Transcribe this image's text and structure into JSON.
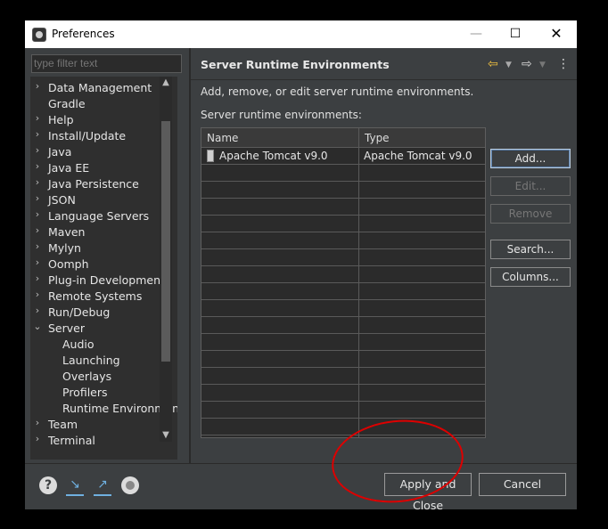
{
  "window": {
    "title": "Preferences",
    "minimize": "—",
    "maximize": "☐",
    "close": "✕"
  },
  "filter": {
    "placeholder": "type filter text"
  },
  "tree": [
    {
      "label": "Data Management",
      "expand": ">",
      "indent": 0
    },
    {
      "label": "Gradle",
      "expand": "",
      "indent": 0
    },
    {
      "label": "Help",
      "expand": ">",
      "indent": 0
    },
    {
      "label": "Install/Update",
      "expand": ">",
      "indent": 0
    },
    {
      "label": "Java",
      "expand": ">",
      "indent": 0
    },
    {
      "label": "Java EE",
      "expand": ">",
      "indent": 0
    },
    {
      "label": "Java Persistence",
      "expand": ">",
      "indent": 0
    },
    {
      "label": "JSON",
      "expand": ">",
      "indent": 0
    },
    {
      "label": "Language Servers",
      "expand": ">",
      "indent": 0
    },
    {
      "label": "Maven",
      "expand": ">",
      "indent": 0
    },
    {
      "label": "Mylyn",
      "expand": ">",
      "indent": 0
    },
    {
      "label": "Oomph",
      "expand": ">",
      "indent": 0
    },
    {
      "label": "Plug-in Development",
      "expand": ">",
      "indent": 0
    },
    {
      "label": "Remote Systems",
      "expand": ">",
      "indent": 0
    },
    {
      "label": "Run/Debug",
      "expand": ">",
      "indent": 0
    },
    {
      "label": "Server",
      "expand": "v",
      "indent": 0
    },
    {
      "label": "Audio",
      "expand": "",
      "indent": 1
    },
    {
      "label": "Launching",
      "expand": "",
      "indent": 1
    },
    {
      "label": "Overlays",
      "expand": "",
      "indent": 1
    },
    {
      "label": "Profilers",
      "expand": "",
      "indent": 1
    },
    {
      "label": "Runtime Environmen",
      "expand": "",
      "indent": 1
    },
    {
      "label": "Team",
      "expand": ">",
      "indent": 0
    },
    {
      "label": "Terminal",
      "expand": ">",
      "indent": 0
    }
  ],
  "page": {
    "title": "Server Runtime Environments",
    "description": "Add, remove, or edit server runtime environments.",
    "list_label": "Server runtime environments:"
  },
  "table": {
    "columns": [
      "Name",
      "Type"
    ],
    "rows": [
      {
        "name": "Apache Tomcat v9.0",
        "type": "Apache Tomcat v9.0"
      }
    ]
  },
  "buttons": {
    "add": "Add...",
    "edit": "Edit...",
    "remove": "Remove",
    "search": "Search...",
    "columns": "Columns..."
  },
  "footer": {
    "apply_close": "Apply and Close",
    "cancel": "Cancel"
  },
  "icons": {
    "help": "?"
  },
  "colors": {
    "annotation": "#dd0000",
    "nav_arrow": "#f0c040"
  }
}
